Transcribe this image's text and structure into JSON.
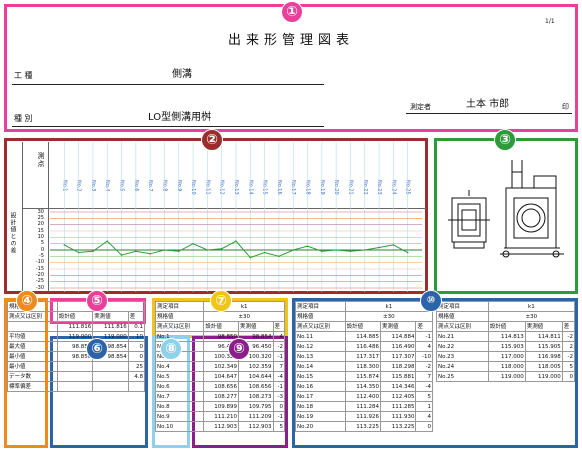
{
  "header": {
    "page_no": "1/1",
    "title": "出来形管理図表",
    "work_type_label": "工 種",
    "work_type_value": "側溝",
    "category_label": "種 別",
    "category_value": "LO型側溝用桝",
    "surveyor_label": "測定者",
    "surveyor_name": "土本 市郎",
    "seal": "印"
  },
  "chart": {
    "ylabel_top": "測点",
    "ylabel_bottom": "設計値との差",
    "x_labels": [
      "No.1",
      "No.2",
      "No.3",
      "No.4",
      "No.5",
      "No.6",
      "No.7",
      "No.8",
      "No.9",
      "No.10",
      "No.11",
      "No.12",
      "No.13",
      "No.14",
      "No.15",
      "No.16",
      "No.17",
      "No.18",
      "No.19",
      "No.20",
      "No.21",
      "No.22",
      "No.23",
      "No.24",
      "No.25"
    ],
    "y_ticks": [
      "30",
      "25",
      "20",
      "15",
      "10",
      "5",
      "0",
      "-5",
      "-10",
      "-15",
      "-20",
      "-25",
      "-30"
    ]
  },
  "chart_data": {
    "type": "line",
    "title": "",
    "xlabel": "測点",
    "ylabel": "設計値との差",
    "ylim": [
      -30,
      30
    ],
    "x": [
      "No.1",
      "No.2",
      "No.3",
      "No.4",
      "No.5",
      "No.6",
      "No.7",
      "No.8",
      "No.9",
      "No.10",
      "No.11",
      "No.12",
      "No.13",
      "No.14",
      "No.15",
      "No.16",
      "No.17",
      "No.18",
      "No.19",
      "No.20",
      "No.21",
      "No.22",
      "No.23",
      "No.24",
      "No.25"
    ],
    "values": [
      4,
      -2,
      -1,
      7,
      -4,
      -1,
      -3,
      0,
      -1,
      5,
      0,
      1,
      7,
      -6,
      -2,
      -5,
      0,
      3,
      -1,
      0,
      -1,
      0,
      2,
      4,
      -2
    ]
  },
  "annotations": {
    "n1": "①",
    "n2": "②",
    "n3": "③",
    "n4": "④",
    "n5": "⑤",
    "n6": "⑥",
    "n7": "⑦",
    "n8": "⑧",
    "n9": "⑨",
    "n10": "⑩"
  },
  "colors": {
    "pink": "#e8409b",
    "brown": "#9b2d2d",
    "green": "#2e9b3a",
    "orange": "#f08a1c",
    "purple": "#8a1e8a",
    "lightblue": "#8fd0ea",
    "blue": "#2d64a8",
    "yellow": "#f0c419",
    "cyan": "#36b9d6"
  },
  "stats": {
    "head_label": "規格値",
    "head_value": "±30",
    "col_head": "測点又は区別",
    "design": "設計値",
    "measured": "実測値",
    "diff": "差",
    "rows": [
      {
        "label": "",
        "design": "111.816",
        "measured": "111.816",
        "diff": "0.1"
      },
      {
        "label": "平均値",
        "design": "119.000",
        "measured": "119.000",
        "diff": "10"
      },
      {
        "label": "最大値",
        "design": "98.850",
        "measured": "98.854",
        "diff": "0"
      },
      {
        "label": "最小値",
        "design": "98.850",
        "measured": "98.854",
        "diff": "0"
      },
      {
        "label": "最小値",
        "design": "",
        "measured": "",
        "diff": "25"
      },
      {
        "label": "データ数",
        "design": "",
        "measured": "",
        "diff": "4.8"
      },
      {
        "label": "標準偏差",
        "design": "",
        "measured": "",
        "diff": ""
      }
    ]
  },
  "section_head": {
    "survey": "測定項目",
    "item": "k1",
    "spec": "規格値",
    "spec_value": "±30"
  },
  "tableA": [
    {
      "no": "No.1",
      "d": "98.850",
      "m": "98.854",
      "diff": "4"
    },
    {
      "no": "No.2",
      "d": "96.450",
      "m": "96.450",
      "diff": "-2"
    },
    {
      "no": "No.3",
      "d": "100.320",
      "m": "100.320",
      "diff": "-1"
    },
    {
      "no": "No.4",
      "d": "102.349",
      "m": "102.359",
      "diff": "7"
    },
    {
      "no": "No.5",
      "d": "104.647",
      "m": "104.644",
      "diff": "-4"
    },
    {
      "no": "No.6",
      "d": "108.656",
      "m": "108.656",
      "diff": "-1"
    },
    {
      "no": "No.7",
      "d": "108.277",
      "m": "108.273",
      "diff": "-3"
    },
    {
      "no": "No.8",
      "d": "109.899",
      "m": "109.795",
      "diff": "0"
    },
    {
      "no": "No.9",
      "d": "111.210",
      "m": "111.209",
      "diff": "-1"
    },
    {
      "no": "No.10",
      "d": "112.903",
      "m": "112.903",
      "diff": "5"
    }
  ],
  "tableB": [
    {
      "no": "No.11",
      "d": "114.885",
      "m": "114.884",
      "diff": "-1"
    },
    {
      "no": "No.12",
      "d": "116.486",
      "m": "116.490",
      "diff": "4"
    },
    {
      "no": "No.13",
      "d": "117.317",
      "m": "117.307",
      "diff": "-10"
    },
    {
      "no": "No.14",
      "d": "118.300",
      "m": "118.298",
      "diff": "-2"
    },
    {
      "no": "No.15",
      "d": "115.874",
      "m": "115.881",
      "diff": "7"
    },
    {
      "no": "No.16",
      "d": "114.350",
      "m": "114.346",
      "diff": "-4"
    },
    {
      "no": "No.17",
      "d": "112.400",
      "m": "112.405",
      "diff": "5"
    },
    {
      "no": "No.18",
      "d": "111.284",
      "m": "111.285",
      "diff": "1"
    },
    {
      "no": "No.19",
      "d": "111.926",
      "m": "111.930",
      "diff": "4"
    },
    {
      "no": "No.20",
      "d": "113.225",
      "m": "113.225",
      "diff": "0"
    }
  ],
  "tableC": [
    {
      "no": "No.21",
      "d": "114.813",
      "m": "114.811",
      "diff": "-2"
    },
    {
      "no": "No.22",
      "d": "115.903",
      "m": "115.905",
      "diff": "2"
    },
    {
      "no": "No.23",
      "d": "117.000",
      "m": "116.998",
      "diff": "-2"
    },
    {
      "no": "No.24",
      "d": "118.000",
      "m": "118.005",
      "diff": "5"
    },
    {
      "no": "No.25",
      "d": "119.000",
      "m": "119.000",
      "diff": "0"
    }
  ]
}
